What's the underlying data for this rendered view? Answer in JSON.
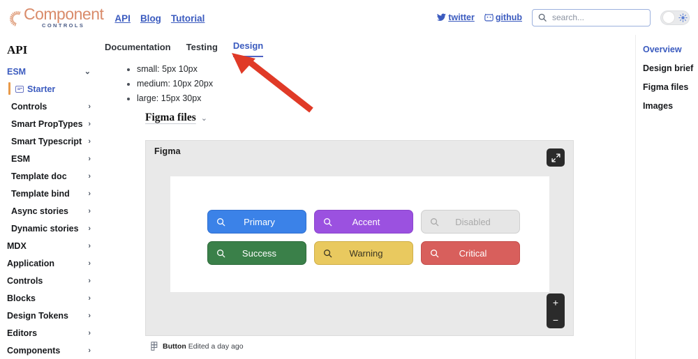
{
  "header": {
    "logo_main": "Component",
    "logo_sub": "CONTROLS",
    "nav": [
      {
        "label": "API"
      },
      {
        "label": "Blog"
      },
      {
        "label": "Tutorial"
      }
    ],
    "twitter_label": "twitter",
    "github_label": "github",
    "search": {
      "value": "",
      "placeholder": "search..."
    },
    "theme_toggle": {
      "state": "light",
      "icon": "sun-icon"
    }
  },
  "sidebar": {
    "title": "API",
    "items": [
      {
        "label": "ESM",
        "type": "group",
        "chevron": "⌄",
        "indent": 0
      },
      {
        "label": "Starter",
        "type": "active",
        "icon": "doc-icon",
        "indent": 1
      },
      {
        "label": "Controls",
        "type": "link",
        "chevron": "›",
        "indent": 1
      },
      {
        "label": "Smart PropTypes",
        "type": "link",
        "chevron": "›",
        "indent": 1
      },
      {
        "label": "Smart Typescript",
        "type": "link",
        "chevron": "›",
        "indent": 1
      },
      {
        "label": "ESM",
        "type": "link",
        "chevron": "›",
        "indent": 1
      },
      {
        "label": "Template doc",
        "type": "link",
        "chevron": "›",
        "indent": 1
      },
      {
        "label": "Template bind",
        "type": "link",
        "chevron": "›",
        "indent": 1
      },
      {
        "label": "Async stories",
        "type": "link",
        "chevron": "›",
        "indent": 1
      },
      {
        "label": "Dynamic stories",
        "type": "link",
        "chevron": "›",
        "indent": 1
      },
      {
        "label": "MDX",
        "type": "link",
        "chevron": "›",
        "indent": 0
      },
      {
        "label": "Application",
        "type": "link",
        "chevron": "›",
        "indent": 0
      },
      {
        "label": "Controls",
        "type": "link",
        "chevron": "›",
        "indent": 0
      },
      {
        "label": "Blocks",
        "type": "link",
        "chevron": "›",
        "indent": 0
      },
      {
        "label": "Design Tokens",
        "type": "link",
        "chevron": "›",
        "indent": 0
      },
      {
        "label": "Editors",
        "type": "link",
        "chevron": "›",
        "indent": 0
      },
      {
        "label": "Components",
        "type": "link",
        "chevron": "›",
        "indent": 0
      }
    ]
  },
  "main": {
    "tabs": [
      {
        "label": "Documentation",
        "active": false
      },
      {
        "label": "Testing",
        "active": false
      },
      {
        "label": "Design",
        "active": true
      }
    ],
    "bullets": [
      "small: 5px 10px",
      "medium: 10px 20px",
      "large: 15px 30px"
    ],
    "section": {
      "title": "Figma files",
      "chevron": "⌄"
    },
    "figma": {
      "label": "Figma",
      "expand_icon": "expand-icon",
      "zoom_in": "+",
      "zoom_out": "−",
      "footer_name": "Button",
      "footer_meta": "Edited a day ago",
      "buttons": [
        {
          "label": "Primary",
          "bg": "#3b82e8",
          "fg": "#ffffff",
          "border": "#2f6fd0"
        },
        {
          "label": "Accent",
          "bg": "#9b51e0",
          "fg": "#ffffff",
          "border": "#8a44cc"
        },
        {
          "label": "Disabled",
          "bg": "#e6e6e6",
          "fg": "#a9a9a9",
          "border": "#cfcfcf"
        },
        {
          "label": "Success",
          "bg": "#3a8049",
          "fg": "#ffffff",
          "border": "#2f6b3c"
        },
        {
          "label": "Warning",
          "bg": "#e9c95f",
          "fg": "#3a3522",
          "border": "#cfae48"
        },
        {
          "label": "Critical",
          "bg": "#d85f5c",
          "fg": "#ffffff",
          "border": "#c34d4a"
        }
      ]
    }
  },
  "toc": {
    "items": [
      {
        "label": "Overview",
        "active": true
      },
      {
        "label": "Design brief",
        "active": false
      },
      {
        "label": "Figma files",
        "active": false
      },
      {
        "label": "Images",
        "active": false
      }
    ]
  },
  "annotation": {
    "type": "arrow",
    "color": "#e03a27",
    "points_to": "Design tab"
  }
}
